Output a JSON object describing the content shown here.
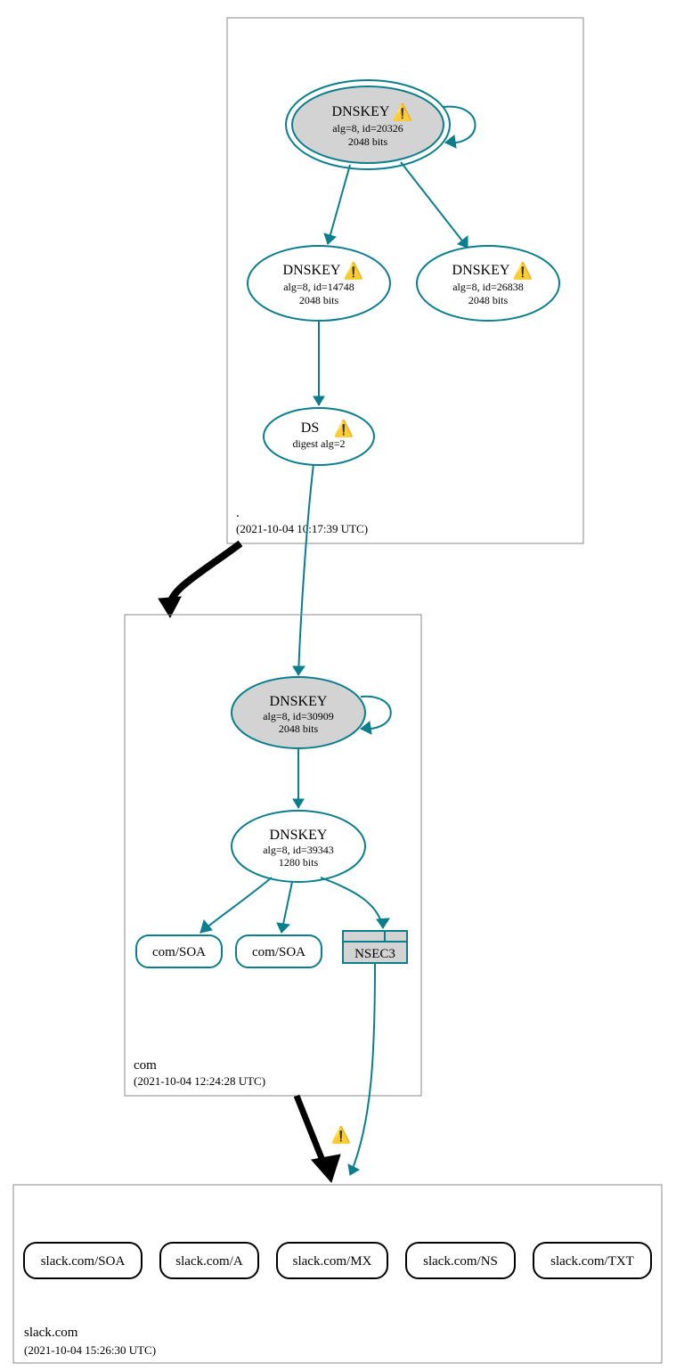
{
  "colors": {
    "teal": "#0a7e8c",
    "nodefill": "#d3d3d3"
  },
  "icons": {
    "warn": "⚠️"
  },
  "zones": {
    "root": {
      "label": ".",
      "date": "(2021-10-04 10:17:39 UTC)"
    },
    "com": {
      "label": "com",
      "date": "(2021-10-04 12:24:28 UTC)"
    },
    "slack": {
      "label": "slack.com",
      "date": "(2021-10-04 15:26:30 UTC)"
    }
  },
  "nodes": {
    "root_ksk": {
      "title": "DNSKEY",
      "warn": true,
      "sub1": "alg=8, id=20326",
      "sub2": "2048 bits"
    },
    "root_zsk1": {
      "title": "DNSKEY",
      "warn": true,
      "sub1": "alg=8, id=14748",
      "sub2": "2048 bits"
    },
    "root_zsk2": {
      "title": "DNSKEY",
      "warn": true,
      "sub1": "alg=8, id=26838",
      "sub2": "2048 bits"
    },
    "root_ds": {
      "title": "DS",
      "warn": true,
      "sub1": "digest alg=2"
    },
    "com_ksk": {
      "title": "DNSKEY",
      "sub1": "alg=8, id=30909",
      "sub2": "2048 bits"
    },
    "com_zsk": {
      "title": "DNSKEY",
      "sub1": "alg=8, id=39343",
      "sub2": "1280 bits"
    },
    "com_soa1": {
      "label": "com/SOA"
    },
    "com_soa2": {
      "label": "com/SOA"
    },
    "com_nsec3": {
      "label": "NSEC3"
    },
    "slack_soa": {
      "label": "slack.com/SOA"
    },
    "slack_a": {
      "label": "slack.com/A"
    },
    "slack_mx": {
      "label": "slack.com/MX"
    },
    "slack_ns": {
      "label": "slack.com/NS"
    },
    "slack_txt": {
      "label": "slack.com/TXT"
    }
  },
  "edge_warn": true
}
